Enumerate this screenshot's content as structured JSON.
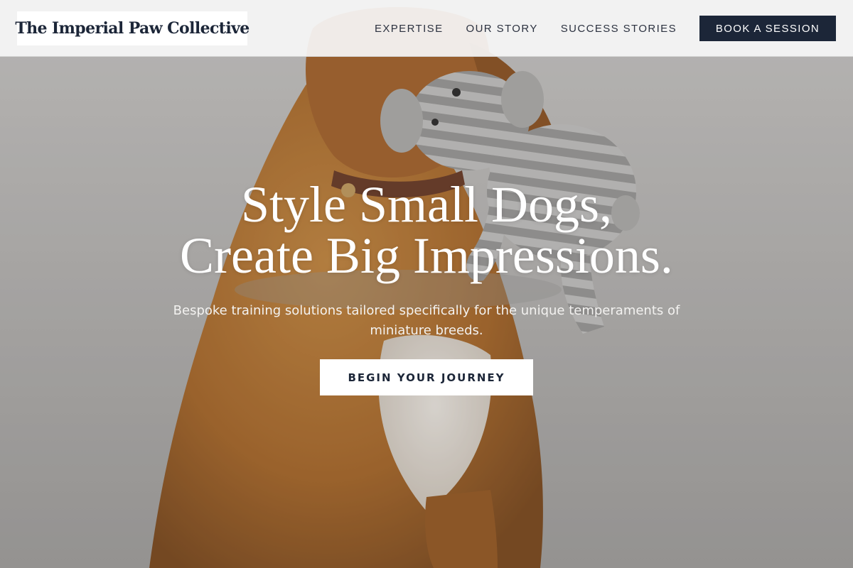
{
  "brand": {
    "name": "The Imperial Paw Collective"
  },
  "nav": {
    "links": [
      {
        "label": "EXPERTISE"
      },
      {
        "label": "OUR STORY"
      },
      {
        "label": "SUCCESS STORIES"
      }
    ],
    "cta_label": "BOOK A SESSION"
  },
  "hero": {
    "headline_line1": "Style Small Dogs,",
    "headline_line2": "Create Big Impressions.",
    "subtitle": "Bespoke training solutions tailored specifically for the unique temperaments of miniature breeds.",
    "cta_label": "BEGIN YOUR JOURNEY",
    "image_subject": "dog-holding-plush-elephant"
  },
  "colors": {
    "navy": "#1c2638",
    "white": "#ffffff",
    "header_bg": "#f6f6f6",
    "backdrop_gray": "#a9a8a6",
    "dog_fur": "#b8742e"
  }
}
